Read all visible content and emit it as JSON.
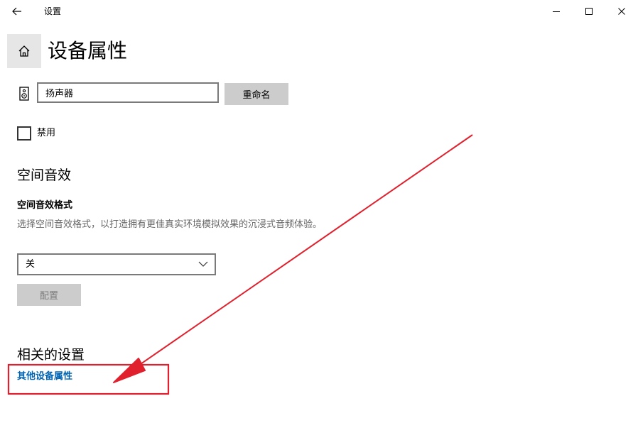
{
  "window": {
    "title": "设置",
    "back_icon": "arrow-left-icon",
    "minimize_icon": "minimize-icon",
    "maximize_icon": "maximize-icon",
    "close_icon": "close-icon"
  },
  "header": {
    "home_icon": "home-icon",
    "title": "设备属性"
  },
  "device": {
    "icon": "speaker-icon",
    "name_value": "扬声器",
    "rename_label": "重命名"
  },
  "disable": {
    "label": "禁用",
    "checked": false
  },
  "spatial_sound": {
    "heading": "空间音效",
    "format_label": "空间音效格式",
    "description": "选择空间音效格式，以打造拥有更佳真实环境模拟效果的沉浸式音频体验。",
    "selected_value": "关",
    "config_label": "配置"
  },
  "related": {
    "heading": "相关的设置",
    "link_label": "其他设备属性"
  },
  "colors": {
    "accent_link": "#0063b1",
    "annotation_red": "#e0202c",
    "button_gray": "#cccccc",
    "home_bg": "#e6e6e6"
  }
}
